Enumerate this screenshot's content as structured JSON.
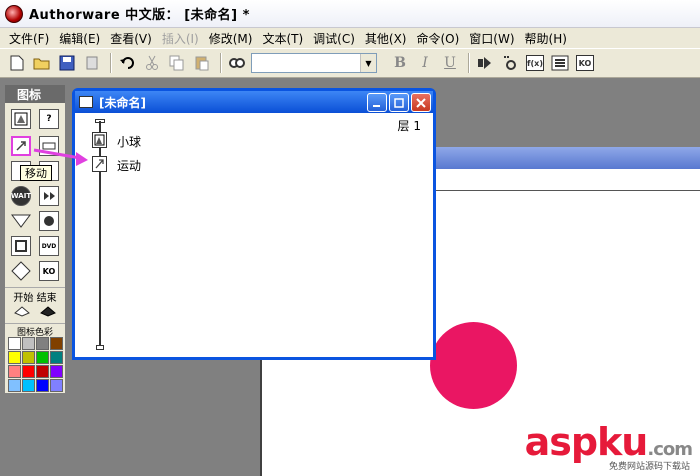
{
  "window": {
    "title": "Authorware 中文版： [未命名] *"
  },
  "menu": [
    "文件(F)",
    "编辑(E)",
    "查看(V)",
    "插入(I)",
    "修改(M)",
    "文本(T)",
    "调试(C)",
    "其他(X)",
    "命令(O)",
    "窗口(W)",
    "帮助(H)"
  ],
  "menu_disabled": [
    "插入(I)"
  ],
  "toolbar": {
    "bold": "B",
    "italic": "I",
    "underline": "U",
    "btn_fx": "f(x)",
    "btn_ko": "KO"
  },
  "palette": {
    "title": "图标",
    "tooltip": "移动",
    "start_end": "开始 结束",
    "colors_label": "图标色彩",
    "wait_label": "WAIT",
    "dvd_label": "DVD",
    "ko_label": "KO",
    "swatch_colors": [
      "#ffffff",
      "#c0c0c0",
      "#808080",
      "#804000",
      "#ffff00",
      "#c0c000",
      "#00c000",
      "#008080",
      "#ff8080",
      "#ff0000",
      "#c00000",
      "#8000ff",
      "#80c0ff",
      "#00c0ff",
      "#0000ff",
      "#8080ff"
    ]
  },
  "flow_window": {
    "title": "[未命名]",
    "layer": "层 1",
    "items": [
      {
        "label": "小球"
      },
      {
        "label": "运动"
      }
    ]
  },
  "stage": {
    "ball_color": "#ea1663"
  },
  "watermark": {
    "text": "asp",
    "text2": "ku",
    "suffix": ".com",
    "sub": "免费网站源码下载站"
  }
}
